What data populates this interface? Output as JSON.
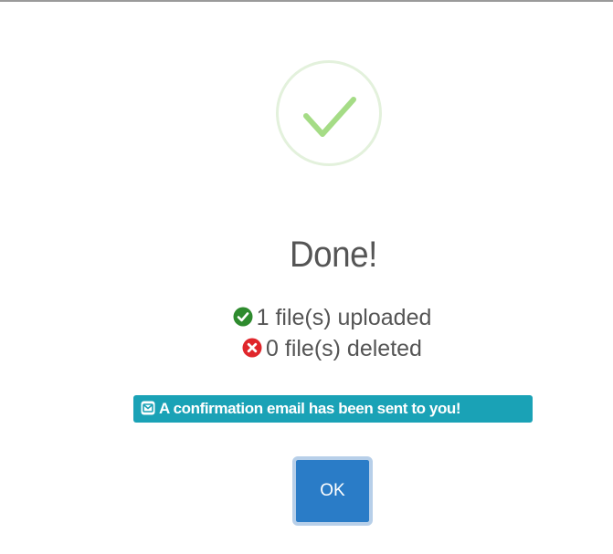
{
  "dialog": {
    "icon": "checkmark-icon",
    "title": "Done!",
    "stats": [
      {
        "icon": "check-circle-icon",
        "color": "#2e8b2e",
        "text": "1 file(s) uploaded"
      },
      {
        "icon": "x-circle-icon",
        "color": "#e0262b",
        "text": "0 file(s) deleted"
      }
    ],
    "notice": {
      "icon": "envelope-icon",
      "text": "A confirmation email has been sent to you!",
      "color": "#1aa2b6"
    },
    "ok_label": "OK",
    "ok_color": "#2a7cc7",
    "success_color": "#a5dc86"
  }
}
